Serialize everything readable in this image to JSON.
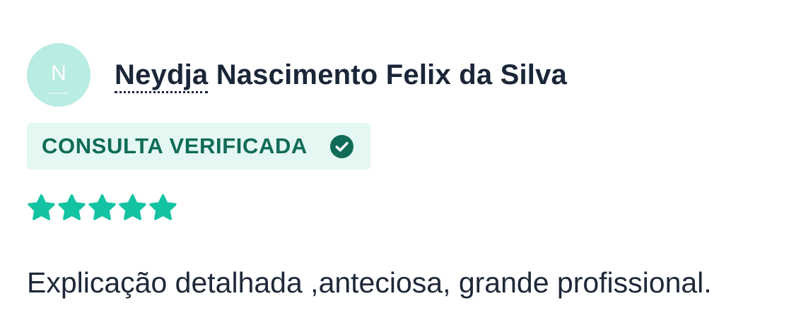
{
  "review": {
    "avatar_initial": "N",
    "author_first": "Neydja",
    "author_rest": " Nascimento Felix da Silva",
    "badge_label": "CONSULTA VERIFICADA",
    "badge_icon": "check-circle-icon",
    "rating": 5,
    "rating_max": 5,
    "comment": "Explicação detalhada ,anteciosa, grande profissional."
  },
  "colors": {
    "avatar_bg": "#b9ece3",
    "badge_bg": "#e4f7f3",
    "badge_text": "#0f6b57",
    "star": "#13c3a1"
  }
}
